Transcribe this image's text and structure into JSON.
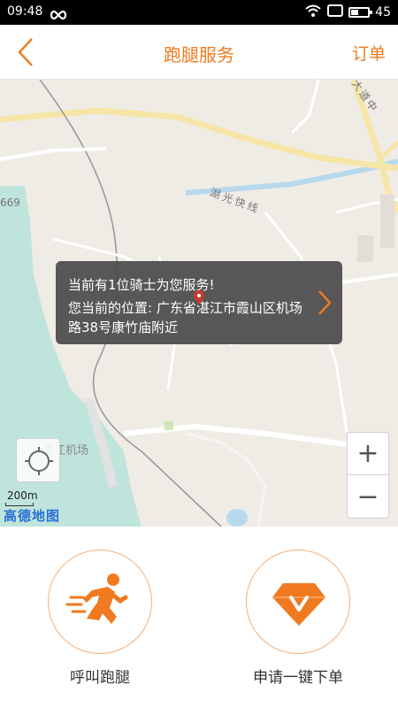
{
  "status_bar": {
    "time": "09:48",
    "battery": "45",
    "battery_level": 0.45,
    "icons": [
      "infinity-icon",
      "wifi-icon",
      "sim-icon",
      "battery-icon"
    ]
  },
  "header": {
    "title": "跑腿服务",
    "orders_label": "订单",
    "back_icon": "chevron-left-icon",
    "accent_color": "#f07a1f"
  },
  "map": {
    "road_labels": [
      "湖光快线",
      "大道中",
      "669"
    ],
    "airport_label": "湛江机场",
    "scale": "200m",
    "provider_logo": "高德地图",
    "info": {
      "line1": "当前有1位骑士为您服务!",
      "line2": "您当前的位置: 广东省湛江市霞山区机场路38号康竹庙附近"
    },
    "zoom_in": "+",
    "zoom_out": "−"
  },
  "actions": [
    {
      "label": "呼叫跑腿",
      "icon": "running-man-icon"
    },
    {
      "label": "申请一键下单",
      "icon": "diamond-v-icon"
    }
  ]
}
